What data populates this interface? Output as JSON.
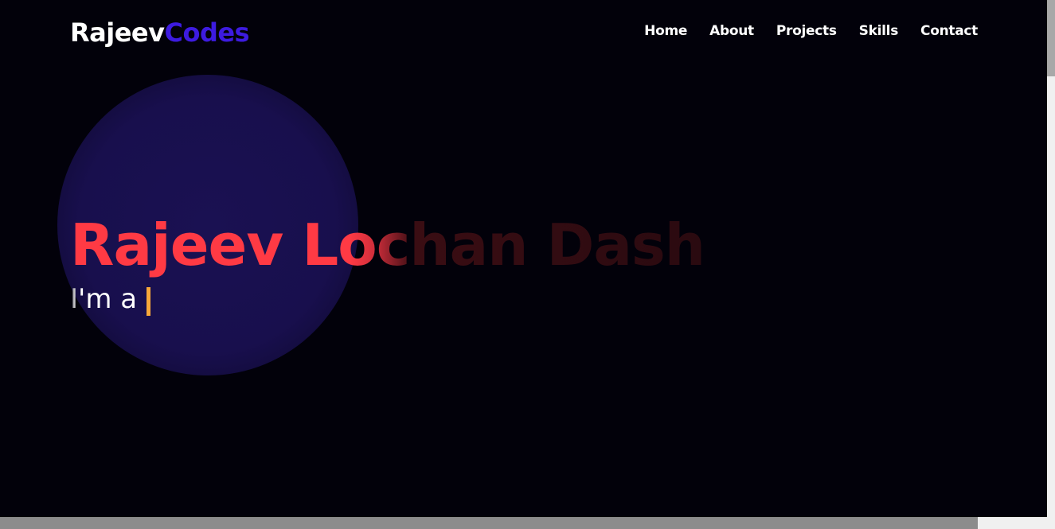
{
  "navbar": {
    "logo_first": "Rajeev",
    "logo_second": "Codes",
    "links": [
      "Home",
      "About",
      "Projects",
      "Skills",
      "Contact"
    ]
  },
  "hero": {
    "name": "Rajeev Lochan Dash",
    "subtitle": "I'm a",
    "cursor": "|"
  },
  "colors": {
    "background": "#02010a",
    "accent_blue": "#3d1be0",
    "name_red": "#ff3a44",
    "cursor_orange": "#f7a83a",
    "blob_indigo": "#1a1152"
  }
}
